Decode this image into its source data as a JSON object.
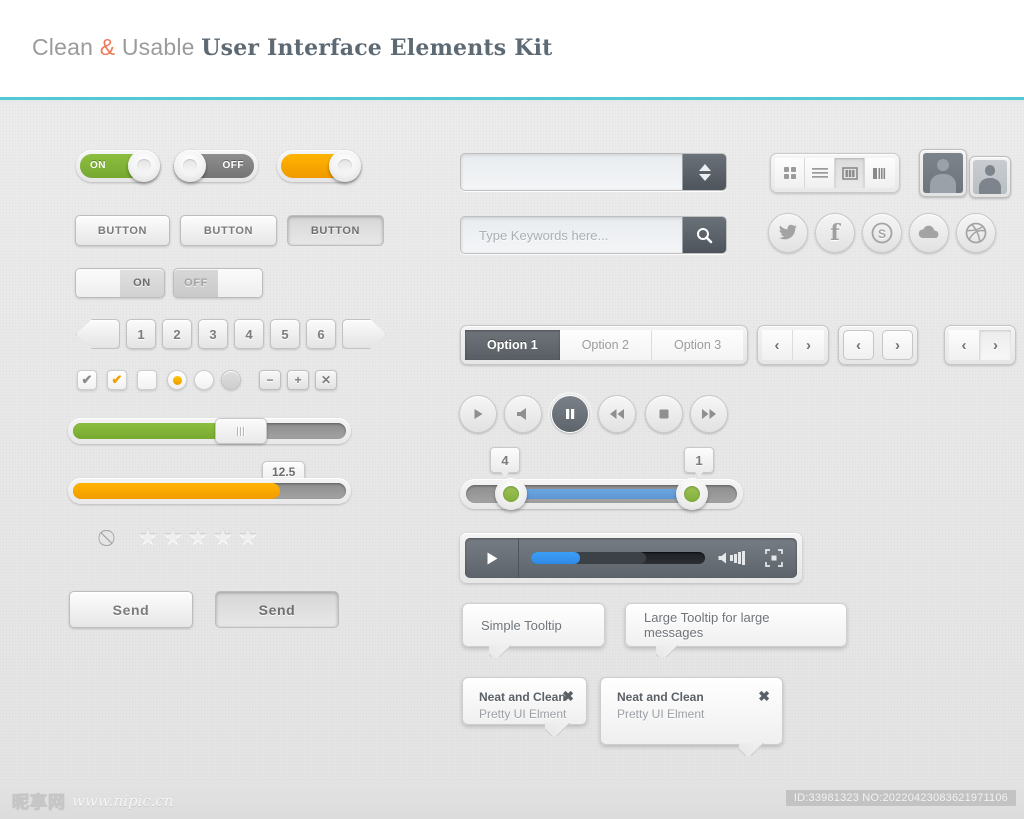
{
  "header": {
    "title_plain_1": "Clean ",
    "title_amp": "&",
    "title_plain_2": " Usable ",
    "title_bold": "User Interface Elements Kit",
    "accent_color": "#52c8d4",
    "amp_color": "#f0795a"
  },
  "toggles": {
    "big": [
      {
        "label": "ON",
        "state": "on",
        "color": "#8cbe3f"
      },
      {
        "label": "OFF",
        "state": "off",
        "color": "#8e8e8e"
      },
      {
        "label": "",
        "state": "on",
        "color": "#ffb400"
      }
    ],
    "small": [
      {
        "label": "ON",
        "state": "on"
      },
      {
        "label": "OFF",
        "state": "off"
      }
    ]
  },
  "buttons": {
    "row1": [
      {
        "label": "BUTTON",
        "state": "normal"
      },
      {
        "label": "BUTTON",
        "state": "normal"
      },
      {
        "label": "BUTTON",
        "state": "pressed"
      }
    ],
    "send": [
      {
        "label": "Send",
        "state": "normal"
      },
      {
        "label": "Send",
        "state": "pressed"
      }
    ]
  },
  "pagination": {
    "prev_icon": "chevron-left",
    "next_icon": "chevron-right",
    "pages": [
      "1",
      "2",
      "3",
      "4",
      "5",
      "6"
    ]
  },
  "form_controls": {
    "checkboxes": [
      {
        "state": "checked",
        "mark": "✔",
        "color": "#8a8a8a"
      },
      {
        "state": "checked",
        "mark": "✔",
        "color": "#f0a000"
      },
      {
        "state": "unchecked",
        "mark": "",
        "color": ""
      }
    ],
    "radios": [
      {
        "state": "selected",
        "color": "#ffc400"
      },
      {
        "state": "unselected",
        "color": ""
      },
      {
        "state": "disabled",
        "color": ""
      }
    ],
    "tiny_buttons": [
      {
        "label": "−",
        "name": "minus"
      },
      {
        "label": "+",
        "name": "plus"
      },
      {
        "label": "✕",
        "name": "close"
      }
    ]
  },
  "progress": {
    "green": {
      "value": 56,
      "fill_color": "#8cbe3f",
      "handle": "grip"
    },
    "amber": {
      "value": 77,
      "fill_color": "#ffb400",
      "tooltip": "12.5"
    }
  },
  "rating": {
    "no_rating_icon": "⃠",
    "stars": 5,
    "filled": 0,
    "star_glyph": "★"
  },
  "inputs": {
    "number_field": {
      "value": "",
      "placeholder": "",
      "addon": "spinner"
    },
    "search_field": {
      "value": "",
      "placeholder": "Type Keywords here...",
      "addon": "search-icon"
    }
  },
  "view_toggle": {
    "options": [
      {
        "name": "grid-view",
        "active": false
      },
      {
        "name": "list-view",
        "active": false
      },
      {
        "name": "column-view",
        "active": true
      },
      {
        "name": "gallery-view",
        "active": false
      }
    ]
  },
  "avatars": [
    {
      "name": "avatar-large",
      "style": "dark"
    },
    {
      "name": "avatar-small",
      "style": "light"
    }
  ],
  "social": [
    {
      "name": "twitter-icon",
      "glyph": "🐦"
    },
    {
      "name": "facebook-icon",
      "glyph": "f"
    },
    {
      "name": "skype-icon",
      "glyph": "S"
    },
    {
      "name": "cloud-icon",
      "glyph": "☁"
    },
    {
      "name": "dribbble-icon",
      "glyph": "⚽"
    }
  ],
  "tabs": [
    {
      "label": "Option 1",
      "active": true
    },
    {
      "label": "Option 2",
      "active": false
    },
    {
      "label": "Option 3",
      "active": false
    }
  ],
  "nav_groups": [
    {
      "prev": "‹",
      "next": "›",
      "style": "joined"
    },
    {
      "prev": "‹",
      "next": "›",
      "style": "split"
    },
    {
      "prev": "‹",
      "next": "›",
      "style": "joined-active"
    }
  ],
  "media_buttons": [
    {
      "name": "play-icon",
      "glyph": "▶",
      "active": false
    },
    {
      "name": "volume-icon",
      "glyph": "◀",
      "active": false
    },
    {
      "name": "pause-icon",
      "glyph": "▐▐",
      "active": true
    },
    {
      "name": "rewind-icon",
      "glyph": "◀◀",
      "active": false
    },
    {
      "name": "stop-icon",
      "glyph": "■",
      "active": false
    },
    {
      "name": "fast-forward-icon",
      "glyph": "▶▶",
      "active": false
    }
  ],
  "range_slider": {
    "left_value": "4",
    "right_value": "1",
    "handle_color": "#8fbb48",
    "fill_color": "#6aa5e0"
  },
  "video_player": {
    "play_icon": "▶",
    "progress_percent": 28,
    "buffered_percent": 66,
    "volume_icon": "volume-icon",
    "fullscreen_icon": "fullscreen-icon",
    "progress_color": "#3d9ef5"
  },
  "tooltips": [
    {
      "text": "Simple Tooltip"
    },
    {
      "text": "Large Tooltip for large messages"
    }
  ],
  "popovers": [
    {
      "title": "Neat and Clean",
      "subtitle": "Pretty UI Elment",
      "close": "✖"
    },
    {
      "title": "Neat and Clean",
      "subtitle": "Pretty UI Elment",
      "close": "✖"
    }
  ],
  "footer": {
    "logo_cn": "昵享网",
    "logo_url": "www.nipic.cn",
    "id_text": "ID:33981323 NO:20220423083621971106"
  }
}
